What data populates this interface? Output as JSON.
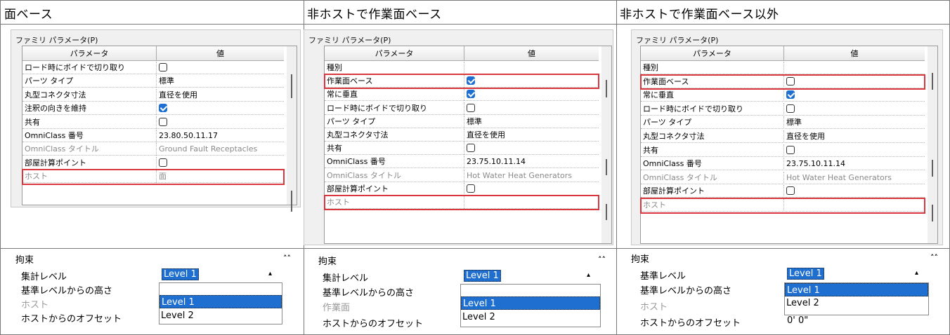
{
  "columns": [
    {
      "title": "面ベース",
      "family_params_label": "ファミリ パラメータ(P)",
      "header": {
        "param": "パラメータ",
        "value": "値"
      },
      "rows": [
        {
          "name": "ロード時にボイドで切り取り",
          "value": "",
          "checkbox": "off",
          "gray": false
        },
        {
          "name": "パーツ タイプ",
          "value": "標準",
          "gray": false
        },
        {
          "name": "丸型コネクタ寸法",
          "value": "直径を使用",
          "gray": false
        },
        {
          "name": "注釈の向きを維持",
          "value": "",
          "checkbox": "on",
          "gray": false
        },
        {
          "name": "共有",
          "value": "",
          "checkbox": "off",
          "gray": false
        },
        {
          "name": "OmniClass 番号",
          "value": "23.80.50.11.17",
          "gray": false
        },
        {
          "name": "OmniClass タイトル",
          "value": "Ground Fault Receptacles",
          "gray": true
        },
        {
          "name": "部屋計算ポイント",
          "value": "",
          "checkbox": "off",
          "gray": false
        },
        {
          "name": "ホスト",
          "value": "面",
          "gray": true
        }
      ],
      "constraints": {
        "title": "拘束",
        "rows": [
          {
            "label": "集計レベル",
            "gray": false
          },
          {
            "label": "基準レベルからの高さ",
            "gray": false
          },
          {
            "label": "ホスト",
            "gray": true
          },
          {
            "label": "ホストからのオフセット",
            "gray": false
          }
        ],
        "selected": "Level 1",
        "options": [
          "Level 1",
          "Level 2"
        ],
        "selected_index": 0,
        "offset_value": ""
      }
    },
    {
      "title": "非ホストで作業面ベース",
      "family_params_label": "ファミリ パラメータ(P)",
      "header": {
        "param": "パラメータ",
        "value": "値"
      },
      "rows": [
        {
          "name": "種別",
          "value": "",
          "gray": false
        },
        {
          "name": "作業面ベース",
          "value": "",
          "checkbox": "on",
          "gray": false
        },
        {
          "name": "常に垂直",
          "value": "",
          "checkbox": "on",
          "gray": false
        },
        {
          "name": "ロード時にボイドで切り取り",
          "value": "",
          "checkbox": "off",
          "gray": false
        },
        {
          "name": "パーツ タイプ",
          "value": "標準",
          "gray": false
        },
        {
          "name": "丸型コネクタ寸法",
          "value": "直径を使用",
          "gray": false
        },
        {
          "name": "共有",
          "value": "",
          "checkbox": "off",
          "gray": false
        },
        {
          "name": "OmniClass 番号",
          "value": "23.75.10.11.14",
          "gray": false
        },
        {
          "name": "OmniClass タイトル",
          "value": "Hot Water Heat Generators",
          "gray": true
        },
        {
          "name": "部屋計算ポイント",
          "value": "",
          "checkbox": "off",
          "gray": false
        },
        {
          "name": "ホスト",
          "value": "",
          "gray": true
        }
      ],
      "constraints": {
        "title": "拘束",
        "rows": [
          {
            "label": "集計レベル",
            "gray": false
          },
          {
            "label": "基準レベルからの高さ",
            "gray": false
          },
          {
            "label": "作業面",
            "gray": true
          },
          {
            "label": "ホストからのオフセット",
            "gray": false
          }
        ],
        "selected": "Level 1",
        "options": [
          "Level 1",
          "Level 2"
        ],
        "selected_index": 0,
        "offset_value": ""
      }
    },
    {
      "title": "非ホストで作業面ベース以外",
      "family_params_label": "ファミリ パラメータ(P)",
      "header": {
        "param": "パラメータ",
        "value": "値"
      },
      "rows": [
        {
          "name": "種別",
          "value": "",
          "gray": false
        },
        {
          "name": "作業面ベース",
          "value": "",
          "checkbox": "off",
          "gray": false
        },
        {
          "name": "常に垂直",
          "value": "",
          "checkbox": "on",
          "gray": false
        },
        {
          "name": "ロード時にボイドで切り取り",
          "value": "",
          "checkbox": "off",
          "gray": false
        },
        {
          "name": "パーツ タイプ",
          "value": "標準",
          "gray": false
        },
        {
          "name": "丸型コネクタ寸法",
          "value": "直径を使用",
          "gray": false
        },
        {
          "name": "共有",
          "value": "",
          "checkbox": "off",
          "gray": false
        },
        {
          "name": "OmniClass 番号",
          "value": "23.75.10.11.14",
          "gray": false
        },
        {
          "name": "OmniClass タイトル",
          "value": "Hot Water Heat Generators",
          "gray": true
        },
        {
          "name": "部屋計算ポイント",
          "value": "",
          "checkbox": "off",
          "gray": false
        },
        {
          "name": "ホスト",
          "value": "",
          "gray": true
        }
      ],
      "constraints": {
        "title": "拘束",
        "rows": [
          {
            "label": "基準レベル",
            "gray": false
          },
          {
            "label": "基準レベルからの高さ",
            "gray": false
          },
          {
            "label": "ホスト",
            "gray": true
          },
          {
            "label": "ホストからのオフセット",
            "gray": false
          }
        ],
        "selected": "Level 1",
        "options": [
          "Level 1",
          "Level 2"
        ],
        "selected_index": 0,
        "offset_value": "0'  0\""
      }
    }
  ],
  "accent_colors": {
    "highlight_red": "#d9363e",
    "selection_blue": "#1e6fd0"
  },
  "icons": {
    "collapse": "double-chevron-up-icon",
    "dropdown": "chevron-up-icon"
  }
}
